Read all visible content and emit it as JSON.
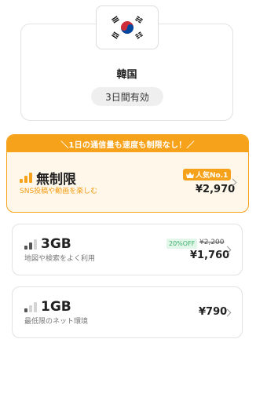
{
  "country": {
    "name": "韓国",
    "validity": "3日間有効",
    "flag_icon": "south-korea-flag-icon"
  },
  "plans": {
    "unlimited": {
      "banner": "＼1日の通信量も速度も制限なし！／",
      "name": "無制限",
      "subtitle": "SNS投稿や動画を楽しむ",
      "badge": "人気No.1",
      "badge_icon": "crown-icon",
      "price": "¥2,970",
      "accent": "#f7a21b"
    },
    "gb3": {
      "name": "3GB",
      "subtitle": "地図や検索をよく利用",
      "discount": "20%OFF",
      "original_price": "¥2,200",
      "price": "¥1,760"
    },
    "gb1": {
      "name": "1GB",
      "subtitle": "最低限のネット環境",
      "price": "¥790"
    }
  }
}
